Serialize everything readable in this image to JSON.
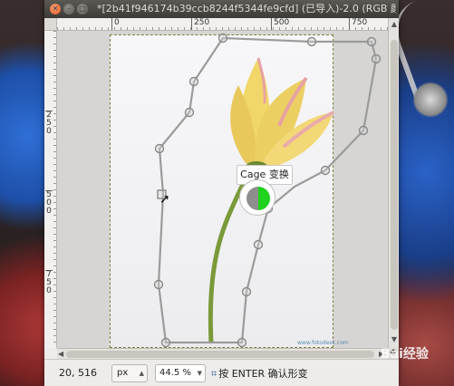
{
  "window": {
    "title": "*[2b41f946174b39ccb8244f5344fe9cfd] (已导入)-2.0 (RGB 颜",
    "close_glyph": "✕",
    "min_glyph": "–",
    "max_glyph": "□"
  },
  "rulers": {
    "horizontal_ticks": [
      "0",
      "250",
      "500",
      "750"
    ],
    "vertical_ticks": [
      "2 5 0",
      "5 0 0",
      "7 5 0"
    ]
  },
  "canvas": {
    "tooltip": "Cage 变换",
    "watermark": "www.fotodesk.com"
  },
  "statusbar": {
    "coords": "20, 516",
    "unit": "px",
    "zoom": "44.5 %",
    "message": "按 ENTER 确认形变",
    "cage_icon": "cage-transform-icon"
  },
  "overlay_logo": "Bai经验",
  "colors": {
    "cage_line": "#9b9b9b",
    "stem": "#7a9a3a",
    "petal": "#f1d66a",
    "petal_tip": "#e7a2a2",
    "tool_green": "#1ed21e"
  }
}
